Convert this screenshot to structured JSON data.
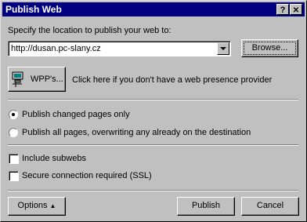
{
  "window": {
    "title": "Publish Web",
    "help_label": "?",
    "close_label": "✕"
  },
  "location": {
    "label_prefix": "Specify the location to publish your web to:",
    "value": "http://dusan.pc-slany.cz",
    "browse_label": "Browse..."
  },
  "wpp": {
    "button_label": "WPP's...",
    "description": "Click here if you don't have a web presence provider"
  },
  "publish_mode": {
    "options": [
      {
        "label": "Publish changed pages only",
        "selected": true
      },
      {
        "label": "Publish all pages, overwriting any already on the destination",
        "selected": false
      }
    ]
  },
  "options": {
    "include_subwebs": {
      "label": "Include subwebs",
      "checked": false
    },
    "secure_connection": {
      "label": "Secure connection required (SSL)",
      "checked": false
    }
  },
  "footer": {
    "options_label": "Options",
    "publish_label": "Publish",
    "cancel_label": "Cancel"
  }
}
